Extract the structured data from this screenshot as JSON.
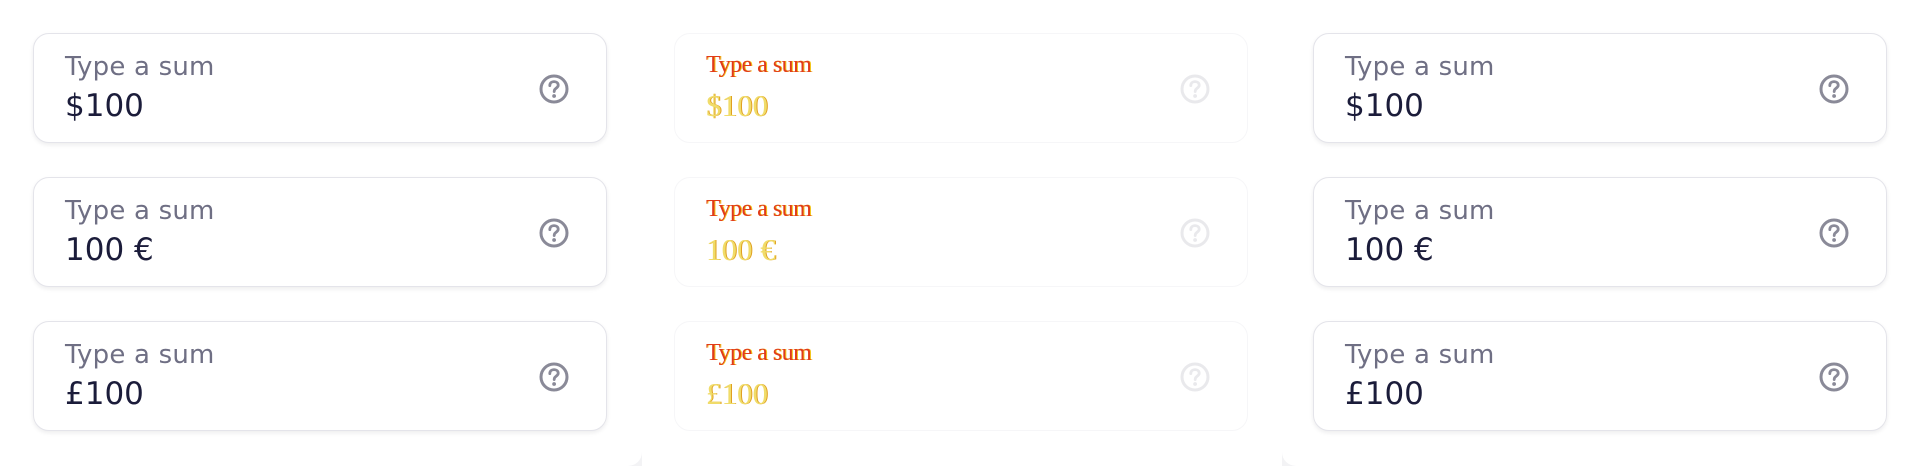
{
  "fields": [
    {
      "state": "default",
      "items": [
        {
          "label": "Type a sum",
          "value": "$100",
          "icon": "help-circle-icon"
        },
        {
          "label": "Type a sum",
          "value": "100 €",
          "icon": "help-circle-icon"
        },
        {
          "label": "Type a sum",
          "value": "£100",
          "icon": "help-circle-icon"
        }
      ]
    },
    {
      "state": "disabled",
      "items": [
        {
          "label": "Type a sum",
          "value": "$100",
          "icon": "help-circle-icon"
        },
        {
          "label": "Type a sum",
          "value": "100 €",
          "icon": "help-circle-icon"
        },
        {
          "label": "Type a sum",
          "value": "£100",
          "icon": "help-circle-icon"
        }
      ]
    },
    {
      "state": "default",
      "items": [
        {
          "label": "Type a sum",
          "value": "$100",
          "icon": "help-circle-icon"
        },
        {
          "label": "Type a sum",
          "value": "100 €",
          "icon": "help-circle-icon"
        },
        {
          "label": "Type a sum",
          "value": "£100",
          "icon": "help-circle-icon"
        }
      ]
    }
  ],
  "colors": {
    "label": "#6f6f84",
    "value": "#1b1c3a",
    "border": "#e4e4ea",
    "icon": "#8a8a98"
  }
}
